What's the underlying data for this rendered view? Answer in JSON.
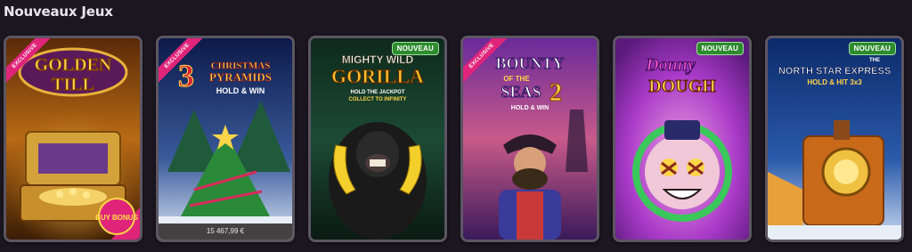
{
  "section": {
    "title": "Nouveaux Jeux"
  },
  "games": [
    {
      "logo_lines": [
        "GOLDEN",
        "TILL"
      ],
      "ribbon": "EXCLUSIVE",
      "corner_badge": "BUY BONUS"
    },
    {
      "logo_lines": [
        "3",
        "CHRISTMAS",
        "PYRAMIDS",
        "HOLD & WIN"
      ],
      "ribbon": "EXCLUSIVE",
      "jackpot": "15 467,99 €"
    },
    {
      "logo_lines": [
        "MIGHTY WILD",
        "GORILLA",
        "HOLD THE JACKPOT",
        "COLLECT TO INFINITY"
      ],
      "badge": "NOUVEAU"
    },
    {
      "logo_lines": [
        "BOUNTY",
        "OF THE",
        "SEAS",
        "2",
        "HOLD & WIN"
      ],
      "ribbon": "EXCLUSIVE"
    },
    {
      "logo_lines": [
        "Donny",
        "DOUGH"
      ],
      "badge": "NOUVEAU"
    },
    {
      "logo_lines": [
        "THE",
        "NORTH STAR EXPRESS",
        "HOLD & HIT 3x3"
      ],
      "badge": "NOUVEAU"
    }
  ],
  "colors": {
    "background": "#1c1620",
    "card_border": "#5c5662",
    "new_badge": "#2e8b2e",
    "exclusive_ribbon": "#e0247a"
  }
}
